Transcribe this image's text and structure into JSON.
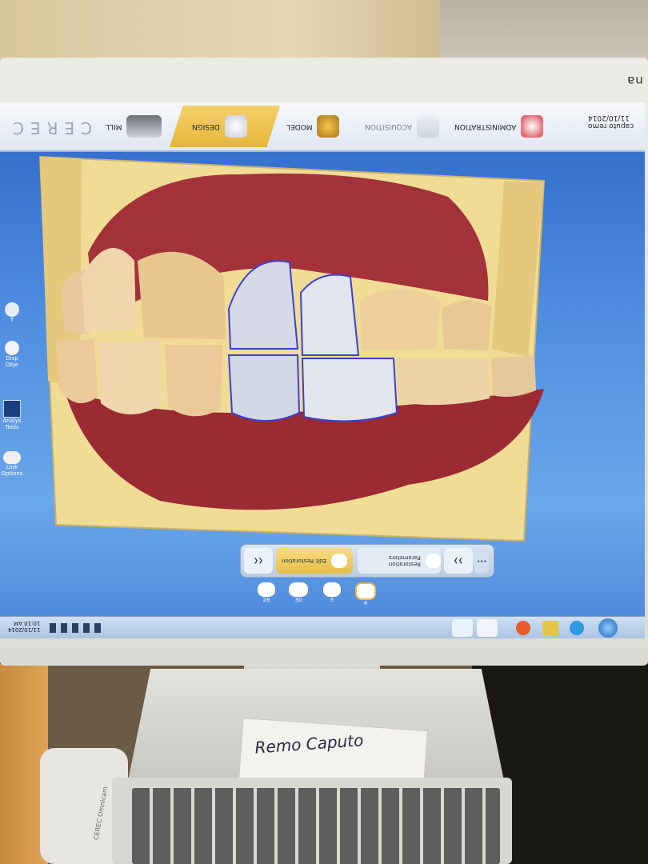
{
  "monitor": {
    "brand": "na"
  },
  "app": {
    "logo": "CEREC"
  },
  "nav": [
    {
      "label": "MILL",
      "icon": "mill-machine-icon"
    },
    {
      "label": "DESIGN",
      "icon": "design-crown-icon",
      "active": true
    },
    {
      "label": "MODEL",
      "icon": "model-icon"
    },
    {
      "label": "ACQUISITION",
      "icon": "camera-acquisition-icon"
    },
    {
      "label": "ADMINISTRATION",
      "icon": "jaw-administration-icon"
    }
  ],
  "patient": {
    "name": "caputo remo",
    "date": "11/10/2014"
  },
  "sidebar": [
    {
      "label": "T"
    },
    {
      "label": "Disp Obje"
    },
    {
      "label": "Analys Tools"
    },
    {
      "label": "Link Options"
    }
  ],
  "toolbar": {
    "edit_restoration": "Edit Restoration",
    "restoration_parameters": "Restoration Parameters"
  },
  "teeth": [
    "28",
    "30",
    "5",
    "4"
  ],
  "taskbar": {
    "time": "10:10 AM",
    "date": "11/10/2014"
  },
  "note": {
    "text": "Remo Caputo"
  },
  "keyboard": {
    "brand": "CEREC Omnicam"
  },
  "colors": {
    "accent": "#e6b63a",
    "screen": "#4f8ee0",
    "gum": "#9e2c34",
    "stone": "#f2dc92"
  }
}
